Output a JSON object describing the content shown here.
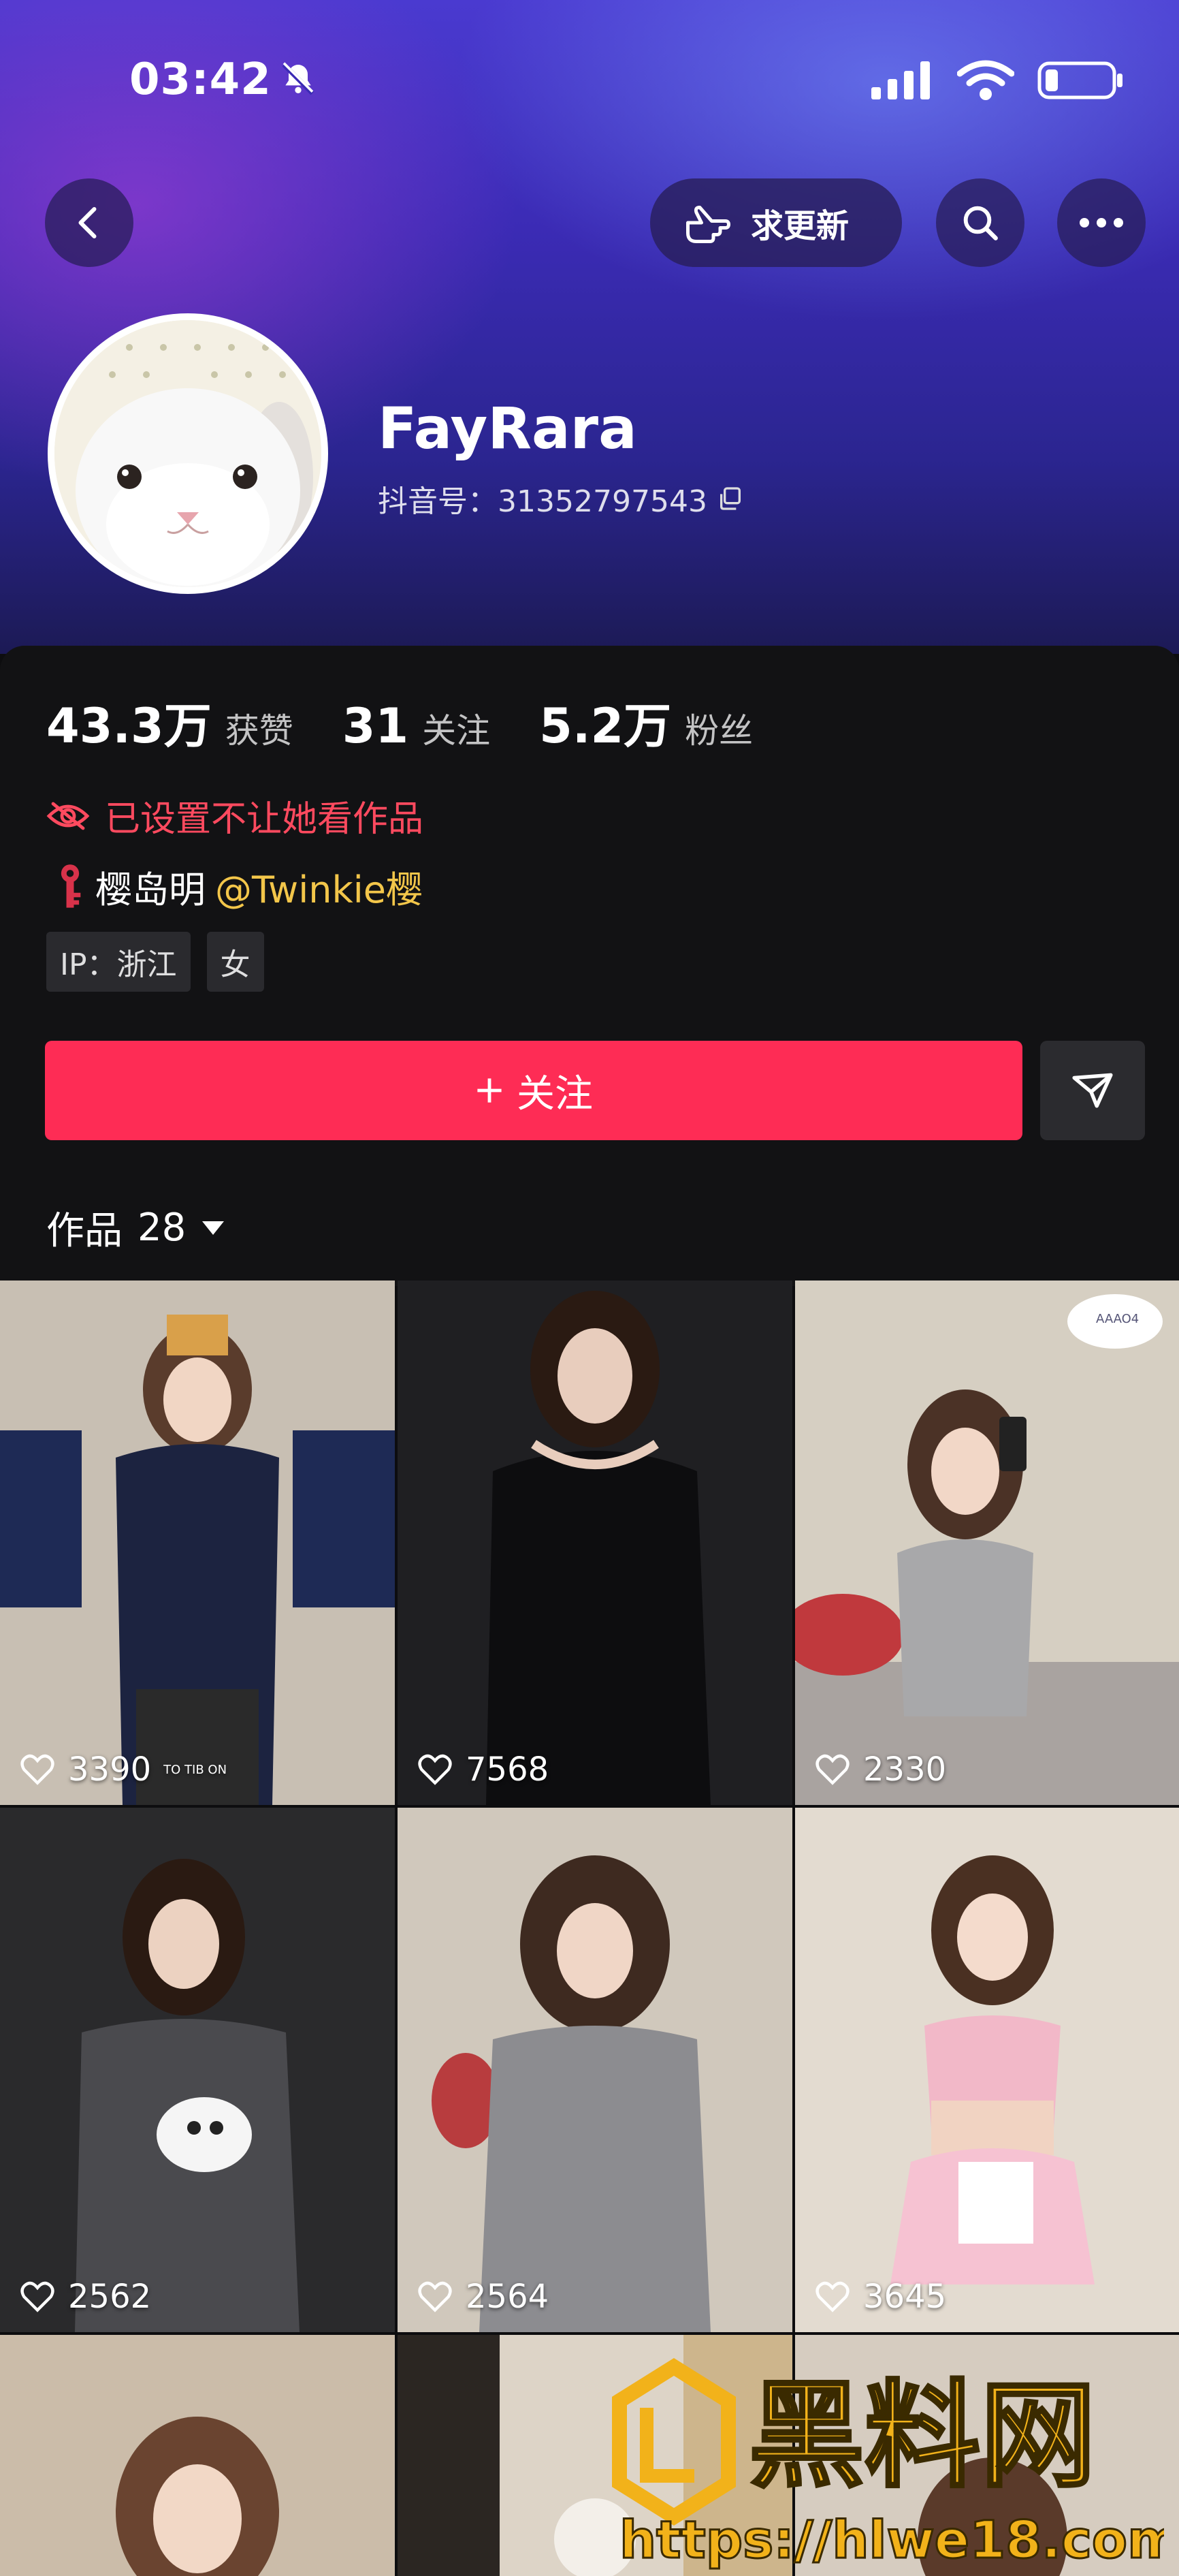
{
  "status_bar": {
    "time": "03:42",
    "icons": [
      "bell-off-icon",
      "signal-icon",
      "wifi-icon",
      "battery-icon"
    ]
  },
  "header": {
    "update_request_label": "求更新",
    "icons": [
      "back-icon",
      "hand-point-icon",
      "search-icon",
      "more-icon"
    ]
  },
  "profile": {
    "name": "FayRara",
    "douyin_id": "抖音号：31352797543",
    "avatar": "white-rabbit"
  },
  "stats": [
    {
      "value": "43.3万",
      "label": "获赞"
    },
    {
      "value": "31",
      "label": "关注"
    },
    {
      "value": "5.2万",
      "label": "粉丝"
    }
  ],
  "privacy_note": "已设置不让她看作品",
  "relation": {
    "name": "樱岛明",
    "mention": "@Twinkie樱"
  },
  "tags": [
    "IP：浙江",
    "女"
  ],
  "follow_button": "关注",
  "works_tab": {
    "label": "作品",
    "count": "28"
  },
  "works": [
    {
      "likes": "3390",
      "overlay": "TO TIB ON"
    },
    {
      "likes": "7568"
    },
    {
      "likes": "2330",
      "bubble": "AAAO4"
    },
    {
      "likes": "2562"
    },
    {
      "likes": "2564"
    },
    {
      "likes": "3645"
    }
  ],
  "watermark": {
    "brand": "黑料网",
    "url": "https://hlwe18.com"
  },
  "colors": {
    "accent": "#fe2c55",
    "privacy": "#ff4a5f",
    "mention": "#f3c64a",
    "background": "#0d0d0f"
  }
}
